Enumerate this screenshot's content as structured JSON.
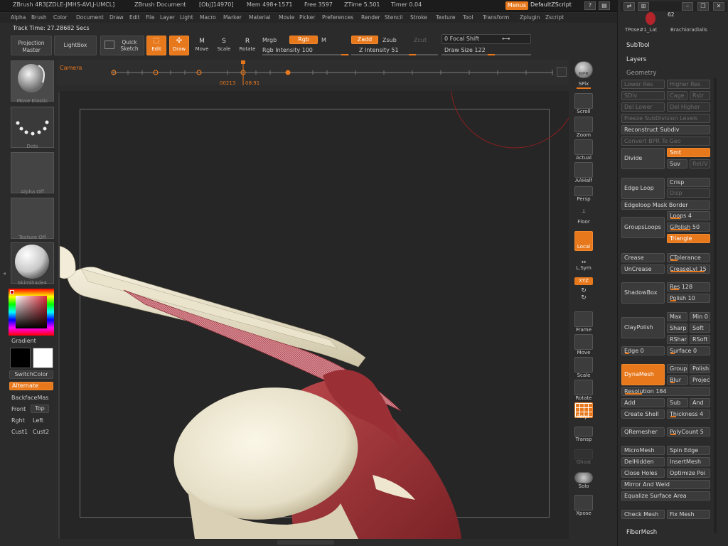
{
  "titlebar": {
    "app": "ZBrush 4R3[ZDLE-JMHS-AVLJ-UMCL]",
    "doc": "ZBrush Document",
    "obj": "[Obj]14970]",
    "mem": "Mem 498+1571",
    "free": "Free 3597",
    "ztime": "ZTime 5.501",
    "timer": "Timer 0.04",
    "menus": "Menus",
    "default_zscript": "DefaultZScript"
  },
  "menubar": [
    "Alpha",
    "Brush",
    "Color",
    "Document",
    "Draw",
    "Edit",
    "File",
    "Layer",
    "Light",
    "Macro",
    "Marker",
    "Material",
    "Movie",
    "Picker",
    "Preferences",
    "Render",
    "Stencil",
    "Stroke",
    "Texture",
    "Tool",
    "Transform",
    "Zplugin",
    "Zscript"
  ],
  "track_time": "Track Time: 27.28682 Secs",
  "toolbar": {
    "projection_master": "Projection Master",
    "lightbox": "LightBox",
    "quick_sketch": "Quick Sketch",
    "edit": "Edit",
    "draw": "Draw",
    "move": "Move",
    "scale": "Scale",
    "rotate": "Rotate",
    "mrgb": "Mrgb",
    "rgb": "Rgb",
    "m": "M",
    "rgb_intensity": "Rgb Intensity 100",
    "zadd": "Zadd",
    "zsub": "Zsub",
    "zcut": "Zcut",
    "z_intensity": "Z Intensity 51",
    "focal_shift": "0 Focal Shift",
    "draw_size": "Draw Size 122"
  },
  "timeline": {
    "camera": "Camera",
    "frame_left": "00213",
    "frame_right": "08:91"
  },
  "left": {
    "brush_caption": "Move Elastic",
    "stroke_caption": "Dots",
    "alpha_caption": "Alpha Off",
    "texture_caption": "Texture Off",
    "material_caption": "SkinShade4",
    "gradient": "Gradient",
    "switchcolor": "SwitchColor",
    "alternate": "Alternate",
    "backfacemask": "BackfaceMas",
    "front": "Front",
    "top": "Top",
    "right": "Rght",
    "left": "Left",
    "cust1": "Cust1",
    "cust2": "Cust2"
  },
  "shelf": {
    "bpr": "BPR",
    "spix": "SPix",
    "scroll": "Scroll",
    "zoom": "Zoom",
    "actual": "Actual",
    "aahalf": "AAHalf",
    "persp": "Persp",
    "floor": "Floor",
    "local": "Local",
    "lsym": "L.Sym",
    "xyz": "XYZ",
    "frame": "Frame",
    "move": "Move",
    "scale": "Scale",
    "rotate": "Rotate",
    "polyf": "PolyF",
    "transp": "Transp",
    "ghost": "Ghost",
    "solo": "Solo",
    "xpose": "Xpose"
  },
  "rpanel": {
    "thumb_count": "62",
    "thumb1": "TPose#1_Lat",
    "thumb2": "Brachioradialis",
    "subtool": "SubTool",
    "layers": "Layers",
    "geometry": "Geometry",
    "lower_res": "Lower Res",
    "higher_res": "Higher Res",
    "sdiv": "SDiv",
    "cage": "Cage",
    "rstr": "Rstr",
    "del_lower": "Del Lower",
    "del_higher": "Del Higher",
    "freeze_subdiv": "Freeze SubDivision Levels",
    "reconstruct_subdiv": "Reconstruct Subdiv",
    "convert_bpr": "Convert BPR To Geo",
    "divide": "Divide",
    "smt": "Smt",
    "suv": "Suv",
    "reuv": "ReUV",
    "edge_loop": "Edge Loop",
    "crisp": "Crisp",
    "disp": "Disp",
    "edgeloop_mask_border": "Edgeloop Mask Border",
    "groupsloops": "GroupsLoops",
    "loops": "Loops 4",
    "gpolish": "GPolish 50",
    "triangle": "Triangle",
    "crease": "Crease",
    "uncrease": "UnCrease",
    "ctolerance": "CTolerance",
    "creaselvl": "CreaseLvl 15",
    "shadowbox": "ShadowBox",
    "res": "Res 128",
    "polish": "Polish 10",
    "claypolish": "ClayPolish",
    "max": "Max",
    "min": "Min 0",
    "sharp": "Sharp",
    "soft": "Soft",
    "rshar": "RShar",
    "rsoft": "RSoft",
    "edge": "Edge 0",
    "surface": "Surface 0",
    "dynamesh": "DynaMesh",
    "group": "Group",
    "polish2": "Polish",
    "blur": "Blur",
    "project": "Projec",
    "resolution": "Resolution 184",
    "add": "Add",
    "sub": "Sub",
    "and": "And",
    "create_shell": "Create Shell",
    "thickness": "Thickness 4",
    "qremesher": "QRemesher",
    "polycount": "PolyCount 5",
    "micromesh": "MicroMesh",
    "spin_edge": "Spin Edge",
    "delhidden": "DelHidden",
    "insertmesh": "InsertMesh",
    "close_holes": "Close Holes",
    "optimize_points": "Optimize Poi",
    "mirror_and_weld": "Mirror And Weld",
    "equalize_surface_area": "Equalize Surface Area",
    "check_mesh": "Check Mesh",
    "fix_mesh": "Fix Mesh",
    "fibermesh": "FiberMesh"
  },
  "colors": {
    "accent": "#e8781c",
    "panel": "#2b2b2b",
    "canvas": "#262626",
    "muscle": "#a8343a",
    "bone": "#e8e2cf"
  }
}
